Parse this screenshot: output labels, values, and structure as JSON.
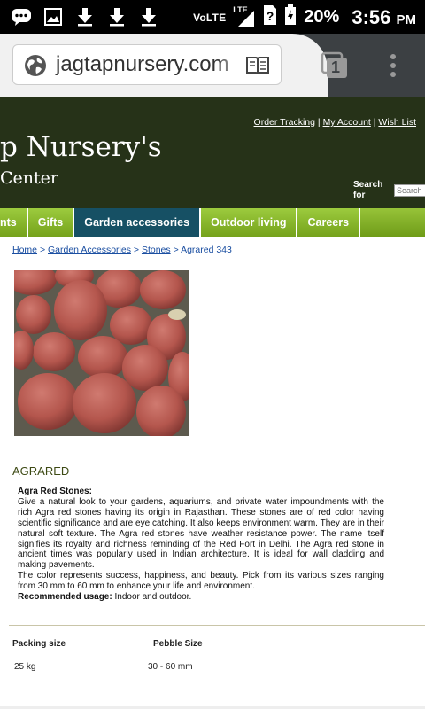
{
  "status_bar": {
    "network": "VoLTE",
    "lte": "LTE",
    "battery_pct": "20%",
    "time": "3:56",
    "ampm": "PM",
    "icons": [
      "messaging-icon",
      "image-icon",
      "download-icon",
      "download-icon",
      "download-icon",
      "signal-icon",
      "sim-icon",
      "battery-icon"
    ]
  },
  "browser": {
    "url": "jagtapnursery.com",
    "tab_count": "1"
  },
  "site": {
    "title": "p Nursery's",
    "subtitle": "Center",
    "top_links": [
      "Order Tracking",
      "My Account",
      "Wish List"
    ],
    "search_label": "Search for",
    "search_placeholder": "Search"
  },
  "nav": {
    "items": [
      {
        "label": "nts",
        "active": false
      },
      {
        "label": "Gifts",
        "active": false
      },
      {
        "label": "Garden accessories",
        "active": true
      },
      {
        "label": "Outdoor living",
        "active": false
      },
      {
        "label": "Careers",
        "active": false
      }
    ]
  },
  "breadcrumb": {
    "items": [
      "Home",
      "Garden Accessories",
      "Stones"
    ],
    "current": "Agrared 343",
    "sep": ">"
  },
  "product": {
    "name": "AGRARED",
    "desc_heading": "Agra Red Stones:",
    "desc_body": "Give a natural look to your gardens, aquariums, and private water impoundments with the rich Agra red stones having its origin in Rajasthan. These stones are of red color having scientific significance and are eye catching. It also keeps environment warm. They are in their natural soft texture. The Agra red stones have weather resistance power. The name itself signifies its royalty and richness reminding of the Red Fort in Delhi. The Agra red stone in ancient times was popularly used in Indian architecture. It is ideal for wall cladding and making pavements.",
    "desc_body2": "The color represents success, happiness, and beauty. Pick from its various sizes ranging from 30 mm to 60 mm to enhance your life and environment.",
    "usage_label": "Recommended usage:",
    "usage_value": "Indoor and outdoor.",
    "spec_headers": [
      "Packing size",
      "Pebble Size"
    ],
    "spec_values": [
      "25 kg",
      "30 - 60 mm"
    ]
  },
  "colors": {
    "header_bg": "#263218",
    "nav_green": "#86b22a",
    "nav_active": "#165064",
    "link": "#1a4ea1",
    "stone": "#b7574f"
  }
}
